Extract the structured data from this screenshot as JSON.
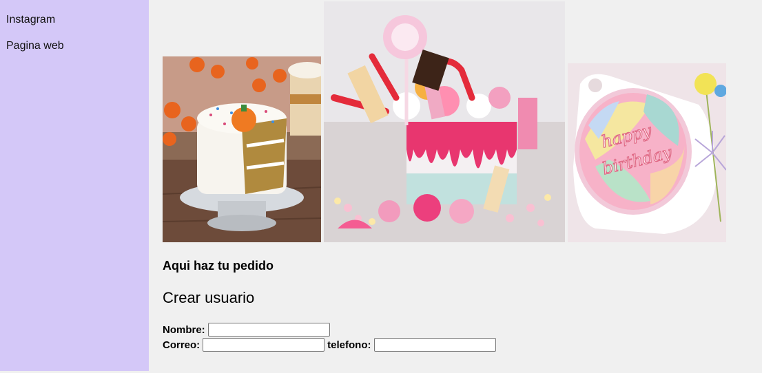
{
  "sidebar": {
    "links": [
      {
        "label": "Instagram"
      },
      {
        "label": "Pagina web"
      }
    ],
    "background_color": "#d4c8f8"
  },
  "gallery": {
    "images": [
      {
        "description_icon": "carrot-cake-icon"
      },
      {
        "description_icon": "candy-drip-cake-icon"
      },
      {
        "description_icon": "happy-birthday-cake-icon"
      }
    ],
    "cake3_text": "happy birthday"
  },
  "order": {
    "title": "Aqui haz tu pedido"
  },
  "form": {
    "title": "Crear usuario",
    "fields": {
      "nombre_label": "Nombre:",
      "nombre_value": "",
      "correo_label": "Correo:",
      "correo_value": "",
      "telefono_label": "telefono:",
      "telefono_value": ""
    }
  }
}
